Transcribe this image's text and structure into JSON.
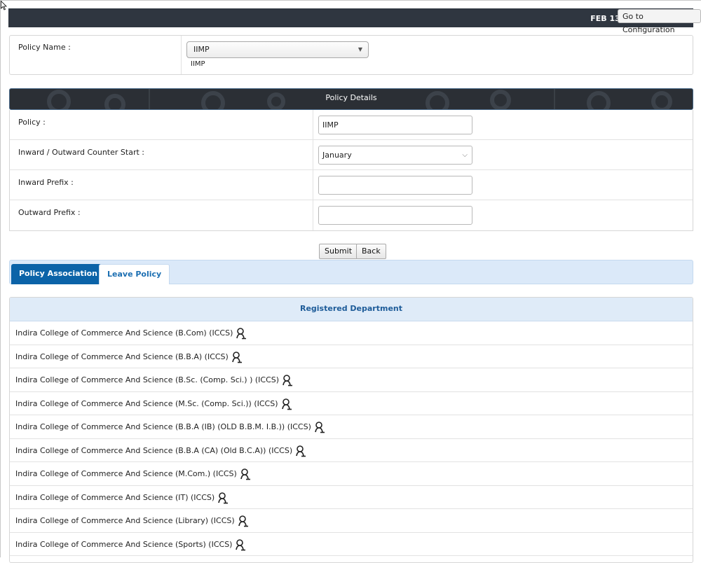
{
  "topbar": {
    "date": "FEB 13,",
    "goto_label": "Go to Configuration"
  },
  "policy_name": {
    "label": "Policy Name :",
    "selected": "IIMP",
    "subvalue": "IIMP"
  },
  "details": {
    "title": "Policy Details",
    "rows": [
      {
        "label": "Policy :",
        "value": "IIMP",
        "kind": "text"
      },
      {
        "label": "Inward / Outward Counter Start :",
        "value": "January",
        "kind": "select"
      },
      {
        "label": "Inward Prefix :",
        "value": "",
        "kind": "text"
      },
      {
        "label": "Outward Prefix :",
        "value": "",
        "kind": "text"
      }
    ]
  },
  "actions": {
    "submit": "Submit",
    "back": "Back"
  },
  "tabs": [
    {
      "label": "Policy Association",
      "active": true
    },
    {
      "label": "Leave Policy",
      "active": false
    }
  ],
  "departments": {
    "title": "Registered Department",
    "items": [
      "Indira College of Commerce And Science (B.Com) (ICCS)",
      "Indira College of Commerce And Science (B.B.A) (ICCS)",
      "Indira College of Commerce And Science (B.Sc. (Comp. Sci.) ) (ICCS)",
      "Indira College of Commerce And Science (M.Sc. (Comp. Sci.)) (ICCS)",
      "Indira College of Commerce And Science (B.B.A (IB) (OLD B.B.M. I.B.)) (ICCS)",
      "Indira College of Commerce And Science (B.B.A (CA) (Old B.C.A)) (ICCS)",
      "Indira College of Commerce And Science (M.Com.) (ICCS)",
      "Indira College of Commerce And Science (IT) (ICCS)",
      "Indira College of Commerce And Science (Library) (ICCS)",
      "Indira College of Commerce And Science (Sports) (ICCS)"
    ]
  },
  "icons": {
    "department_icon": "person-icon",
    "cursor": "mouse-cursor-icon"
  },
  "colors": {
    "topbar": "#2f3640",
    "tab_active": "#0b63a8",
    "tab_bar": "#dbe9f9",
    "dept_title": "#1e5c99"
  }
}
